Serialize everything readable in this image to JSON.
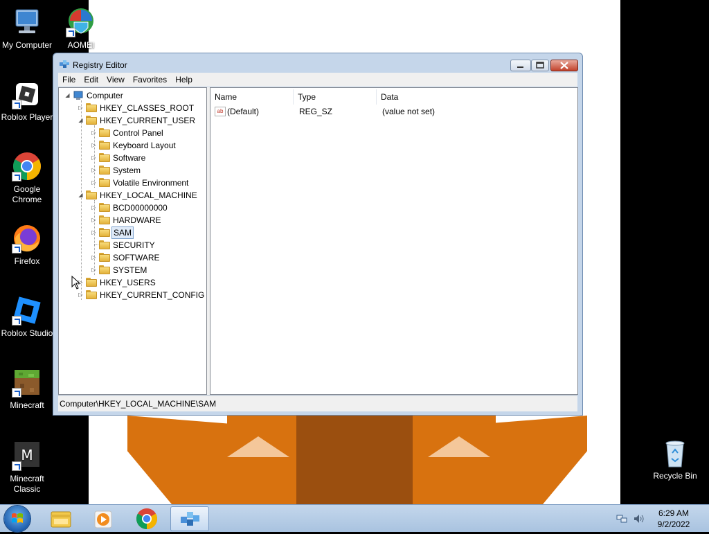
{
  "desktop": {
    "icons": [
      {
        "id": "my-computer",
        "label": "My Computer"
      },
      {
        "id": "aomei",
        "label": "AOMEI"
      },
      {
        "id": "roblox-player",
        "label": "Roblox Player"
      },
      {
        "id": "google-chrome",
        "label": "Google Chrome"
      },
      {
        "id": "firefox",
        "label": "Firefox"
      },
      {
        "id": "roblox-studio",
        "label": "Roblox Studio"
      },
      {
        "id": "minecraft",
        "label": "Minecraft"
      },
      {
        "id": "minecraft-classic",
        "label": "Minecraft Classic"
      },
      {
        "id": "recycle-bin",
        "label": "Recycle Bin"
      }
    ]
  },
  "window": {
    "title": "Registry Editor",
    "menu": [
      "File",
      "Edit",
      "View",
      "Favorites",
      "Help"
    ],
    "tree": [
      {
        "label": "Computer",
        "depth": 0,
        "state": "expanded"
      },
      {
        "label": "HKEY_CLASSES_ROOT",
        "depth": 1,
        "state": "collapsed"
      },
      {
        "label": "HKEY_CURRENT_USER",
        "depth": 1,
        "state": "expanded"
      },
      {
        "label": "Control Panel",
        "depth": 2,
        "state": "collapsed"
      },
      {
        "label": "Keyboard Layout",
        "depth": 2,
        "state": "collapsed"
      },
      {
        "label": "Software",
        "depth": 2,
        "state": "collapsed"
      },
      {
        "label": "System",
        "depth": 2,
        "state": "collapsed"
      },
      {
        "label": "Volatile Environment",
        "depth": 2,
        "state": "collapsed"
      },
      {
        "label": "HKEY_LOCAL_MACHINE",
        "depth": 1,
        "state": "expanded"
      },
      {
        "label": "BCD00000000",
        "depth": 2,
        "state": "collapsed"
      },
      {
        "label": "HARDWARE",
        "depth": 2,
        "state": "collapsed"
      },
      {
        "label": "SAM",
        "depth": 2,
        "state": "collapsed",
        "selected": true
      },
      {
        "label": "SECURITY",
        "depth": 2,
        "state": "leaf"
      },
      {
        "label": "SOFTWARE",
        "depth": 2,
        "state": "collapsed"
      },
      {
        "label": "SYSTEM",
        "depth": 2,
        "state": "collapsed"
      },
      {
        "label": "HKEY_USERS",
        "depth": 1,
        "state": "collapsed"
      },
      {
        "label": "HKEY_CURRENT_CONFIG",
        "depth": 1,
        "state": "collapsed"
      }
    ],
    "columns": [
      "Name",
      "Type",
      "Data"
    ],
    "values": [
      {
        "name": "(Default)",
        "type": "REG_SZ",
        "data": "(value not set)",
        "icon": "string-value-icon"
      }
    ],
    "status": "Computer\\HKEY_LOCAL_MACHINE\\SAM"
  },
  "taskbar": {
    "items": [
      "windows-explorer",
      "windows-media-player",
      "google-chrome",
      "registry-editor"
    ],
    "active": "registry-editor",
    "time": "6:29 AM",
    "date": "9/2/2022"
  }
}
